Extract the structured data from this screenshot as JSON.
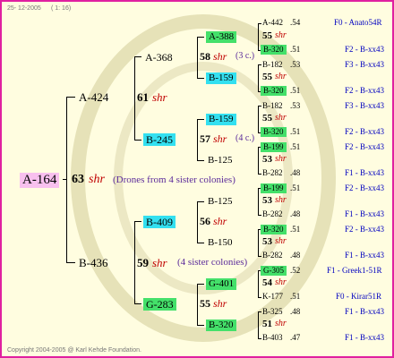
{
  "header": {
    "date": "25- 12-2005",
    "zoom": "( 1: 16)"
  },
  "footer": {
    "copyright": "Copyright 2004-2005 @ Karl Kehde Foundation."
  },
  "colors": {
    "border": "#e020a0",
    "background": "#fffde0",
    "cyan": "#33e0f0",
    "green": "#44e06a",
    "pink": "#f8c0ee",
    "shr": "#c00000",
    "note": "#5a2a9a",
    "origin": "#0000c0"
  },
  "root": {
    "id": "A-164",
    "year": "63",
    "shr": "shr",
    "note": "(Drones from 4 sister colonies)"
  },
  "gen1": [
    {
      "id": "A-424",
      "year": "61",
      "shr": "shr"
    },
    {
      "id": "B-436",
      "year": "59",
      "shr": "shr",
      "note": "(4 sister colonies)"
    }
  ],
  "gen2": [
    {
      "id": "A-368",
      "year": "58",
      "shr": "shr",
      "note": "(3 c.)"
    },
    {
      "id": "B-245",
      "year": "57",
      "shr": "shr",
      "note": "(4 c.)"
    },
    {
      "id": "B-409",
      "year": "56",
      "shr": "shr"
    },
    {
      "id": "G-283",
      "year": "55",
      "shr": "shr"
    }
  ],
  "gen3": [
    {
      "id": "A-388",
      "year": "55",
      "shr": "shr"
    },
    {
      "id": "B-159",
      "year": "55",
      "shr": "shr"
    },
    {
      "id": "B-159",
      "year": "55",
      "shr": "shr"
    },
    {
      "id": "B-125",
      "year": "53",
      "shr": "shr"
    },
    {
      "id": "B-125",
      "year": "53",
      "shr": "shr"
    },
    {
      "id": "B-150",
      "year": "53",
      "shr": "shr"
    },
    {
      "id": "G-401",
      "year": "54",
      "shr": "shr"
    },
    {
      "id": "B-320",
      "year": "51",
      "shr": "shr"
    }
  ],
  "gen4": [
    {
      "id": "A-442",
      "year": ".54",
      "origin": "F0 - Anato54R"
    },
    {
      "id": "B-320",
      "year": ".51",
      "origin": "F2 - B-xx43"
    },
    {
      "id": "B-182",
      "year": ".53",
      "origin": "F3 - B-xx43"
    },
    {
      "id": "B-320",
      "year": ".51",
      "origin": "F2 - B-xx43"
    },
    {
      "id": "B-182",
      "year": ".53",
      "origin": "F3 - B-xx43"
    },
    {
      "id": "B-320",
      "year": ".51",
      "origin": "F2 - B-xx43"
    },
    {
      "id": "B-199",
      "year": ".51",
      "origin": "F2 - B-xx43"
    },
    {
      "id": "B-282",
      "year": ".48",
      "origin": "F1 - B-xx43"
    },
    {
      "id": "B-199",
      "year": ".51",
      "origin": "F2 - B-xx43"
    },
    {
      "id": "B-282",
      "year": ".48",
      "origin": "F1 - B-xx43"
    },
    {
      "id": "B-320",
      "year": ".51",
      "origin": "F2 - B-xx43"
    },
    {
      "id": "B-282",
      "year": ".48",
      "origin": "F1 - B-xx43"
    },
    {
      "id": "G-305",
      "year": ".52",
      "origin": "F1 - Greek1-51R"
    },
    {
      "id": "K-177",
      "year": ".51",
      "origin": "F0 - Kirar51R"
    },
    {
      "id": "B-325",
      "year": ".48",
      "origin": "F1 - B-xx43"
    },
    {
      "id": "B-403",
      "year": ".47",
      "origin": "F1 - B-xx43"
    }
  ]
}
